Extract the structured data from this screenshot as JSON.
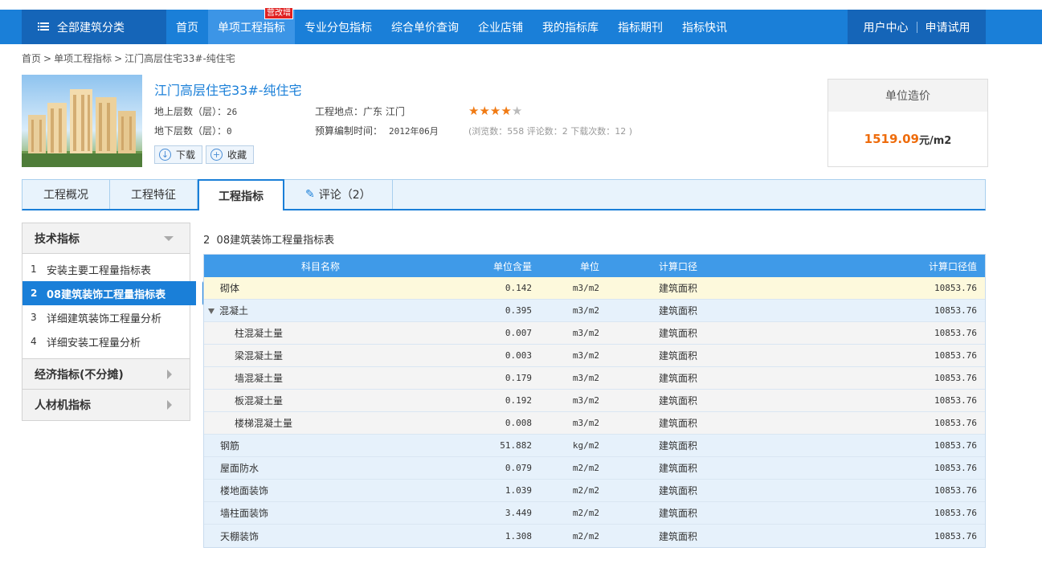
{
  "nav": {
    "category_label": "全部建筑分类",
    "items": [
      {
        "label": "首页",
        "active": false
      },
      {
        "label": "单项工程指标",
        "active": true,
        "badge": "营改增"
      },
      {
        "label": "专业分包指标",
        "active": false
      },
      {
        "label": "综合单价查询",
        "active": false
      },
      {
        "label": "企业店铺",
        "active": false
      },
      {
        "label": "我的指标库",
        "active": false
      },
      {
        "label": "指标期刊",
        "active": false
      },
      {
        "label": "指标快讯",
        "active": false
      }
    ],
    "user_center": "用户中心",
    "apply_trial": "申请试用"
  },
  "breadcrumb": [
    "首页",
    "单项工程指标",
    "江门高层住宅33#-纯住宅"
  ],
  "project": {
    "title": "江门高层住宅33#-纯住宅",
    "above_floors_label": "地上层数（层）：",
    "above_floors": "26",
    "below_floors_label": "地下层数（层）：",
    "below_floors": "0",
    "location_label": "工程地点：",
    "location": "广东 江门",
    "budget_time_label": "预算编制时间：",
    "budget_time": "2012年06月",
    "rating": 4,
    "rating_max": 5,
    "counts_text": "(浏览数：558 评论数：2 下载次数：12 )",
    "download_label": "下载",
    "favorite_label": "收藏"
  },
  "price": {
    "header": "单位造价",
    "value": "1519.09",
    "unit": "元/m2"
  },
  "tabs": [
    {
      "label": "工程概况",
      "active": false
    },
    {
      "label": "工程特征",
      "active": false
    },
    {
      "label": "工程指标",
      "active": true
    },
    {
      "label": "评论（2）",
      "active": false
    }
  ],
  "sidebar": {
    "tech_header": "技术指标",
    "items": [
      {
        "num": "1",
        "label": "安装主要工程量指标表",
        "active": false
      },
      {
        "num": "2",
        "label": "08建筑装饰工程量指标表",
        "active": true
      },
      {
        "num": "3",
        "label": "详细建筑装饰工程量分析",
        "active": false
      },
      {
        "num": "4",
        "label": "详细安装工程量分析",
        "active": false
      }
    ],
    "econ_header": "经济指标(不分摊)",
    "material_header": "人材机指标"
  },
  "table": {
    "title_num": "2",
    "title": "08建筑装饰工程量指标表",
    "columns": [
      "科目名称",
      "单位含量",
      "单位",
      "计算口径",
      "计算口径值"
    ],
    "rows": [
      {
        "name": "砌体",
        "qty": "0.142",
        "unit": "m3/m2",
        "basis": "建筑面积",
        "value": "10853.76",
        "level": "top",
        "style": "yellow"
      },
      {
        "name": "混凝土",
        "qty": "0.395",
        "unit": "m3/m2",
        "basis": "建筑面积",
        "value": "10853.76",
        "level": "parent",
        "style": "blue"
      },
      {
        "name": "柱混凝土量",
        "qty": "0.007",
        "unit": "m3/m2",
        "basis": "建筑面积",
        "value": "10853.76",
        "level": "child",
        "style": "gray"
      },
      {
        "name": "梁混凝土量",
        "qty": "0.003",
        "unit": "m3/m2",
        "basis": "建筑面积",
        "value": "10853.76",
        "level": "child",
        "style": "gray"
      },
      {
        "name": "墙混凝土量",
        "qty": "0.179",
        "unit": "m3/m2",
        "basis": "建筑面积",
        "value": "10853.76",
        "level": "child",
        "style": "gray"
      },
      {
        "name": "板混凝土量",
        "qty": "0.192",
        "unit": "m3/m2",
        "basis": "建筑面积",
        "value": "10853.76",
        "level": "child",
        "style": "gray"
      },
      {
        "name": "楼梯混凝土量",
        "qty": "0.008",
        "unit": "m3/m2",
        "basis": "建筑面积",
        "value": "10853.76",
        "level": "child",
        "style": "gray"
      },
      {
        "name": "钢筋",
        "qty": "51.882",
        "unit": "kg/m2",
        "basis": "建筑面积",
        "value": "10853.76",
        "level": "top",
        "style": "blue"
      },
      {
        "name": "屋面防水",
        "qty": "0.079",
        "unit": "m2/m2",
        "basis": "建筑面积",
        "value": "10853.76",
        "level": "top",
        "style": "blue"
      },
      {
        "name": "楼地面装饰",
        "qty": "1.039",
        "unit": "m2/m2",
        "basis": "建筑面积",
        "value": "10853.76",
        "level": "top",
        "style": "blue"
      },
      {
        "name": "墙柱面装饰",
        "qty": "3.449",
        "unit": "m2/m2",
        "basis": "建筑面积",
        "value": "10853.76",
        "level": "top",
        "style": "blue"
      },
      {
        "name": "天棚装饰",
        "qty": "1.308",
        "unit": "m2/m2",
        "basis": "建筑面积",
        "value": "10853.76",
        "level": "top",
        "style": "blue"
      }
    ]
  },
  "colors": {
    "nav_bg": "#1a7fd8",
    "nav_dark": "#1565b8",
    "accent_orange": "#ee6c0c",
    "table_head": "#3f9ae8"
  }
}
